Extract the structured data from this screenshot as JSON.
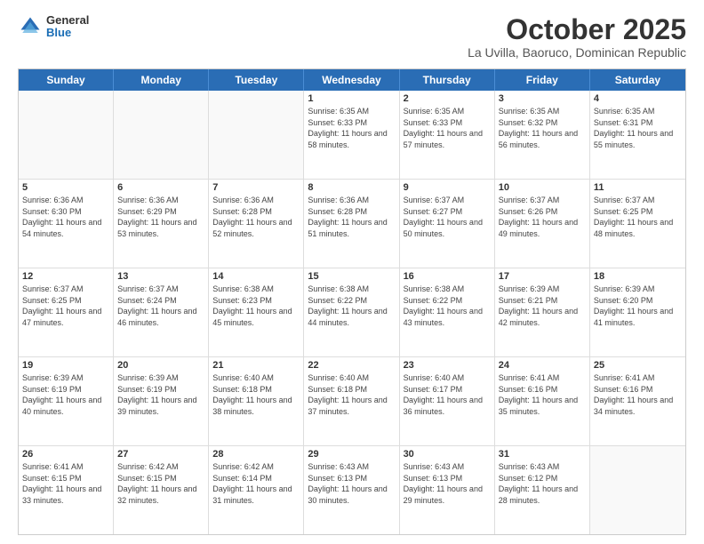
{
  "header": {
    "logo": {
      "general": "General",
      "blue": "Blue"
    },
    "title": "October 2025",
    "subtitle": "La Uvilla, Baoruco, Dominican Republic"
  },
  "weekdays": [
    "Sunday",
    "Monday",
    "Tuesday",
    "Wednesday",
    "Thursday",
    "Friday",
    "Saturday"
  ],
  "weeks": [
    [
      {
        "day": "",
        "sunrise": "",
        "sunset": "",
        "daylight": "",
        "empty": true
      },
      {
        "day": "",
        "sunrise": "",
        "sunset": "",
        "daylight": "",
        "empty": true
      },
      {
        "day": "",
        "sunrise": "",
        "sunset": "",
        "daylight": "",
        "empty": true
      },
      {
        "day": "1",
        "sunrise": "Sunrise: 6:35 AM",
        "sunset": "Sunset: 6:33 PM",
        "daylight": "Daylight: 11 hours and 58 minutes.",
        "empty": false
      },
      {
        "day": "2",
        "sunrise": "Sunrise: 6:35 AM",
        "sunset": "Sunset: 6:33 PM",
        "daylight": "Daylight: 11 hours and 57 minutes.",
        "empty": false
      },
      {
        "day": "3",
        "sunrise": "Sunrise: 6:35 AM",
        "sunset": "Sunset: 6:32 PM",
        "daylight": "Daylight: 11 hours and 56 minutes.",
        "empty": false
      },
      {
        "day": "4",
        "sunrise": "Sunrise: 6:35 AM",
        "sunset": "Sunset: 6:31 PM",
        "daylight": "Daylight: 11 hours and 55 minutes.",
        "empty": false
      }
    ],
    [
      {
        "day": "5",
        "sunrise": "Sunrise: 6:36 AM",
        "sunset": "Sunset: 6:30 PM",
        "daylight": "Daylight: 11 hours and 54 minutes.",
        "empty": false
      },
      {
        "day": "6",
        "sunrise": "Sunrise: 6:36 AM",
        "sunset": "Sunset: 6:29 PM",
        "daylight": "Daylight: 11 hours and 53 minutes.",
        "empty": false
      },
      {
        "day": "7",
        "sunrise": "Sunrise: 6:36 AM",
        "sunset": "Sunset: 6:28 PM",
        "daylight": "Daylight: 11 hours and 52 minutes.",
        "empty": false
      },
      {
        "day": "8",
        "sunrise": "Sunrise: 6:36 AM",
        "sunset": "Sunset: 6:28 PM",
        "daylight": "Daylight: 11 hours and 51 minutes.",
        "empty": false
      },
      {
        "day": "9",
        "sunrise": "Sunrise: 6:37 AM",
        "sunset": "Sunset: 6:27 PM",
        "daylight": "Daylight: 11 hours and 50 minutes.",
        "empty": false
      },
      {
        "day": "10",
        "sunrise": "Sunrise: 6:37 AM",
        "sunset": "Sunset: 6:26 PM",
        "daylight": "Daylight: 11 hours and 49 minutes.",
        "empty": false
      },
      {
        "day": "11",
        "sunrise": "Sunrise: 6:37 AM",
        "sunset": "Sunset: 6:25 PM",
        "daylight": "Daylight: 11 hours and 48 minutes.",
        "empty": false
      }
    ],
    [
      {
        "day": "12",
        "sunrise": "Sunrise: 6:37 AM",
        "sunset": "Sunset: 6:25 PM",
        "daylight": "Daylight: 11 hours and 47 minutes.",
        "empty": false
      },
      {
        "day": "13",
        "sunrise": "Sunrise: 6:37 AM",
        "sunset": "Sunset: 6:24 PM",
        "daylight": "Daylight: 11 hours and 46 minutes.",
        "empty": false
      },
      {
        "day": "14",
        "sunrise": "Sunrise: 6:38 AM",
        "sunset": "Sunset: 6:23 PM",
        "daylight": "Daylight: 11 hours and 45 minutes.",
        "empty": false
      },
      {
        "day": "15",
        "sunrise": "Sunrise: 6:38 AM",
        "sunset": "Sunset: 6:22 PM",
        "daylight": "Daylight: 11 hours and 44 minutes.",
        "empty": false
      },
      {
        "day": "16",
        "sunrise": "Sunrise: 6:38 AM",
        "sunset": "Sunset: 6:22 PM",
        "daylight": "Daylight: 11 hours and 43 minutes.",
        "empty": false
      },
      {
        "day": "17",
        "sunrise": "Sunrise: 6:39 AM",
        "sunset": "Sunset: 6:21 PM",
        "daylight": "Daylight: 11 hours and 42 minutes.",
        "empty": false
      },
      {
        "day": "18",
        "sunrise": "Sunrise: 6:39 AM",
        "sunset": "Sunset: 6:20 PM",
        "daylight": "Daylight: 11 hours and 41 minutes.",
        "empty": false
      }
    ],
    [
      {
        "day": "19",
        "sunrise": "Sunrise: 6:39 AM",
        "sunset": "Sunset: 6:19 PM",
        "daylight": "Daylight: 11 hours and 40 minutes.",
        "empty": false
      },
      {
        "day": "20",
        "sunrise": "Sunrise: 6:39 AM",
        "sunset": "Sunset: 6:19 PM",
        "daylight": "Daylight: 11 hours and 39 minutes.",
        "empty": false
      },
      {
        "day": "21",
        "sunrise": "Sunrise: 6:40 AM",
        "sunset": "Sunset: 6:18 PM",
        "daylight": "Daylight: 11 hours and 38 minutes.",
        "empty": false
      },
      {
        "day": "22",
        "sunrise": "Sunrise: 6:40 AM",
        "sunset": "Sunset: 6:18 PM",
        "daylight": "Daylight: 11 hours and 37 minutes.",
        "empty": false
      },
      {
        "day": "23",
        "sunrise": "Sunrise: 6:40 AM",
        "sunset": "Sunset: 6:17 PM",
        "daylight": "Daylight: 11 hours and 36 minutes.",
        "empty": false
      },
      {
        "day": "24",
        "sunrise": "Sunrise: 6:41 AM",
        "sunset": "Sunset: 6:16 PM",
        "daylight": "Daylight: 11 hours and 35 minutes.",
        "empty": false
      },
      {
        "day": "25",
        "sunrise": "Sunrise: 6:41 AM",
        "sunset": "Sunset: 6:16 PM",
        "daylight": "Daylight: 11 hours and 34 minutes.",
        "empty": false
      }
    ],
    [
      {
        "day": "26",
        "sunrise": "Sunrise: 6:41 AM",
        "sunset": "Sunset: 6:15 PM",
        "daylight": "Daylight: 11 hours and 33 minutes.",
        "empty": false
      },
      {
        "day": "27",
        "sunrise": "Sunrise: 6:42 AM",
        "sunset": "Sunset: 6:15 PM",
        "daylight": "Daylight: 11 hours and 32 minutes.",
        "empty": false
      },
      {
        "day": "28",
        "sunrise": "Sunrise: 6:42 AM",
        "sunset": "Sunset: 6:14 PM",
        "daylight": "Daylight: 11 hours and 31 minutes.",
        "empty": false
      },
      {
        "day": "29",
        "sunrise": "Sunrise: 6:43 AM",
        "sunset": "Sunset: 6:13 PM",
        "daylight": "Daylight: 11 hours and 30 minutes.",
        "empty": false
      },
      {
        "day": "30",
        "sunrise": "Sunrise: 6:43 AM",
        "sunset": "Sunset: 6:13 PM",
        "daylight": "Daylight: 11 hours and 29 minutes.",
        "empty": false
      },
      {
        "day": "31",
        "sunrise": "Sunrise: 6:43 AM",
        "sunset": "Sunset: 6:12 PM",
        "daylight": "Daylight: 11 hours and 28 minutes.",
        "empty": false
      },
      {
        "day": "",
        "sunrise": "",
        "sunset": "",
        "daylight": "",
        "empty": true
      }
    ]
  ]
}
